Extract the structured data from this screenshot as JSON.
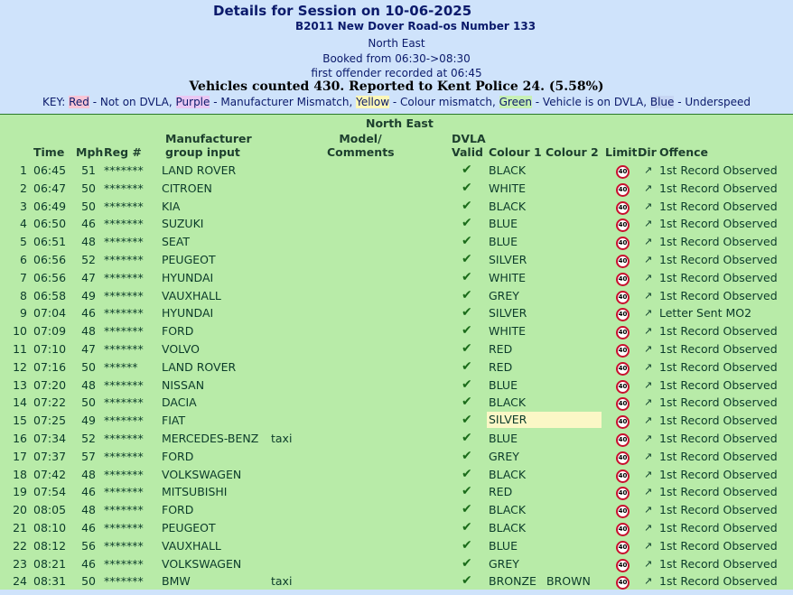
{
  "header": {
    "title": "Details for Session on 10-06-2025",
    "road": "B2011 New Dover Road-os Number 133",
    "region": "North East",
    "booked": "Booked from 06:30->08:30",
    "first_offender": "first offender recorded at 06:45",
    "counted": "Vehicles counted 430.  Reported to Kent Police 24. (5.58%)"
  },
  "key": {
    "prefix": "KEY: ",
    "red": "Red",
    "red_text": " - Not on DVLA, ",
    "purple": "Purple",
    "purple_text": " - Manufacturer Mismatch, ",
    "yellow": "Yellow",
    "yellow_text": " - Colour mismatch, ",
    "green": "Green",
    "green_text": " - Vehicle is on DVLA, ",
    "blue": "Blue",
    "blue_text": " - Underspeed"
  },
  "table": {
    "area": "North East",
    "headers": {
      "time": "Time",
      "mph": "Mph",
      "reg": "Reg #",
      "man1": "Manufacturer",
      "man2": "group input",
      "model1": "Model/",
      "model2": "Comments",
      "dvla1": "DVLA",
      "dvla2": "Valid",
      "colour1": "Colour 1",
      "colour2": "Colour 2",
      "limit": "Limit",
      "dir": "Dir",
      "offence": "Offence"
    },
    "limit_value": "40",
    "dir_glyph": "↗",
    "valid_glyph": "✔",
    "rows": [
      {
        "n": "1",
        "time": "06:45",
        "mph": "51",
        "reg": "*******",
        "man": "LAND ROVER",
        "model": "",
        "c1": "BLACK",
        "c2": "",
        "off": "1st Record Observed"
      },
      {
        "n": "2",
        "time": "06:47",
        "mph": "50",
        "reg": "*******",
        "man": "CITROEN",
        "model": "",
        "c1": "WHITE",
        "c2": "",
        "off": "1st Record Observed"
      },
      {
        "n": "3",
        "time": "06:49",
        "mph": "50",
        "reg": "*******",
        "man": "KIA",
        "model": "",
        "c1": "BLACK",
        "c2": "",
        "off": "1st Record Observed"
      },
      {
        "n": "4",
        "time": "06:50",
        "mph": "46",
        "reg": "*******",
        "man": "SUZUKI",
        "model": "",
        "c1": "BLUE",
        "c2": "",
        "off": "1st Record Observed"
      },
      {
        "n": "5",
        "time": "06:51",
        "mph": "48",
        "reg": "*******",
        "man": "SEAT",
        "model": "",
        "c1": "BLUE",
        "c2": "",
        "off": "1st Record Observed"
      },
      {
        "n": "6",
        "time": "06:56",
        "mph": "52",
        "reg": "*******",
        "man": "PEUGEOT",
        "model": "",
        "c1": "SILVER",
        "c2": "",
        "off": "1st Record Observed"
      },
      {
        "n": "7",
        "time": "06:56",
        "mph": "47",
        "reg": "*******",
        "man": "HYUNDAI",
        "model": "",
        "c1": "WHITE",
        "c2": "",
        "off": "1st Record Observed"
      },
      {
        "n": "8",
        "time": "06:58",
        "mph": "49",
        "reg": "*******",
        "man": "VAUXHALL",
        "model": "",
        "c1": "GREY",
        "c2": "",
        "off": "1st Record Observed"
      },
      {
        "n": "9",
        "time": "07:04",
        "mph": "46",
        "reg": "*******",
        "man": "HYUNDAI",
        "model": "",
        "c1": "SILVER",
        "c2": "",
        "off": "Letter Sent MO2"
      },
      {
        "n": "10",
        "time": "07:09",
        "mph": "48",
        "reg": "*******",
        "man": "FORD",
        "model": "",
        "c1": "WHITE",
        "c2": "",
        "off": "1st Record Observed"
      },
      {
        "n": "11",
        "time": "07:10",
        "mph": "47",
        "reg": "*******",
        "man": "VOLVO",
        "model": "",
        "c1": "RED",
        "c2": "",
        "off": "1st Record Observed"
      },
      {
        "n": "12",
        "time": "07:16",
        "mph": "50",
        "reg": "******",
        "man": "LAND ROVER",
        "model": "",
        "c1": "RED",
        "c2": "",
        "off": "1st Record Observed"
      },
      {
        "n": "13",
        "time": "07:20",
        "mph": "48",
        "reg": "*******",
        "man": "NISSAN",
        "model": "",
        "c1": "BLUE",
        "c2": "",
        "off": "1st Record Observed"
      },
      {
        "n": "14",
        "time": "07:22",
        "mph": "50",
        "reg": "*******",
        "man": "DACIA",
        "model": "",
        "c1": "BLACK",
        "c2": "",
        "off": "1st Record Observed"
      },
      {
        "n": "15",
        "time": "07:25",
        "mph": "49",
        "reg": "*******",
        "man": "FIAT",
        "model": "",
        "c1": "SILVER",
        "c2": "",
        "off": "1st Record Observed",
        "highlight": "yellow"
      },
      {
        "n": "16",
        "time": "07:34",
        "mph": "52",
        "reg": "*******",
        "man": "MERCEDES-BENZ",
        "model": "taxi",
        "c1": "BLUE",
        "c2": "",
        "off": "1st Record Observed"
      },
      {
        "n": "17",
        "time": "07:37",
        "mph": "57",
        "reg": "*******",
        "man": "FORD",
        "model": "",
        "c1": "GREY",
        "c2": "",
        "off": "1st Record Observed"
      },
      {
        "n": "18",
        "time": "07:42",
        "mph": "48",
        "reg": "*******",
        "man": "VOLKSWAGEN",
        "model": "",
        "c1": "BLACK",
        "c2": "",
        "off": "1st Record Observed"
      },
      {
        "n": "19",
        "time": "07:54",
        "mph": "46",
        "reg": "*******",
        "man": "MITSUBISHI",
        "model": "",
        "c1": "RED",
        "c2": "",
        "off": "1st Record Observed"
      },
      {
        "n": "20",
        "time": "08:05",
        "mph": "48",
        "reg": "*******",
        "man": "FORD",
        "model": "",
        "c1": "BLACK",
        "c2": "",
        "off": "1st Record Observed"
      },
      {
        "n": "21",
        "time": "08:10",
        "mph": "46",
        "reg": "*******",
        "man": "PEUGEOT",
        "model": "",
        "c1": "BLACK",
        "c2": "",
        "off": "1st Record Observed"
      },
      {
        "n": "22",
        "time": "08:12",
        "mph": "56",
        "reg": "*******",
        "man": "VAUXHALL",
        "model": "",
        "c1": "BLUE",
        "c2": "",
        "off": "1st Record Observed"
      },
      {
        "n": "23",
        "time": "08:21",
        "mph": "46",
        "reg": "*******",
        "man": "VOLKSWAGEN",
        "model": "",
        "c1": "GREY",
        "c2": "",
        "off": "1st Record Observed"
      },
      {
        "n": "24",
        "time": "08:31",
        "mph": "50",
        "reg": "*******",
        "man": "BMW",
        "model": "taxi",
        "c1": "BRONZE",
        "c2": "BROWN",
        "off": "1st Record Observed"
      }
    ]
  }
}
